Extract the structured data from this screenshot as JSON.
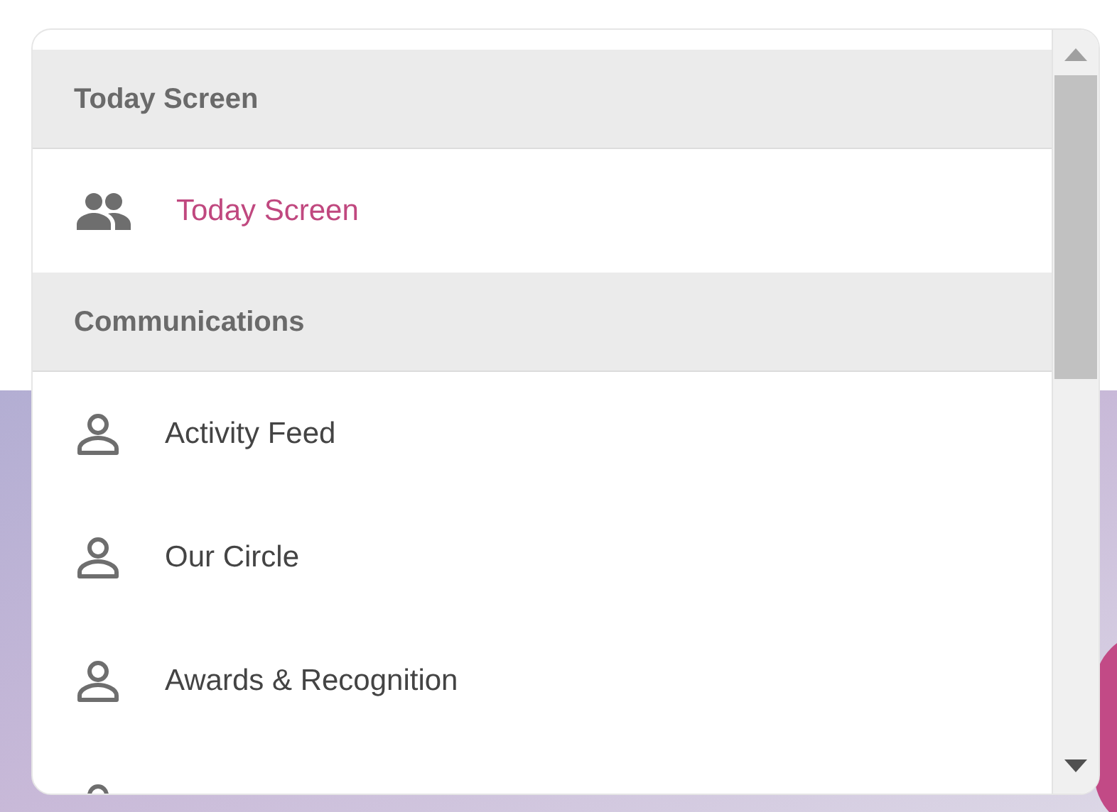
{
  "groups": [
    {
      "header": "Today Screen",
      "items": [
        {
          "label": "Today Screen",
          "kind": "group",
          "selected": true
        }
      ]
    },
    {
      "header": "Communications",
      "items": [
        {
          "label": "Activity Feed",
          "kind": "person",
          "selected": false
        },
        {
          "label": "Our Circle",
          "kind": "person",
          "selected": false
        },
        {
          "label": "Awards & Recognition",
          "kind": "person",
          "selected": false
        },
        {
          "kind": "person"
        }
      ]
    }
  ]
}
